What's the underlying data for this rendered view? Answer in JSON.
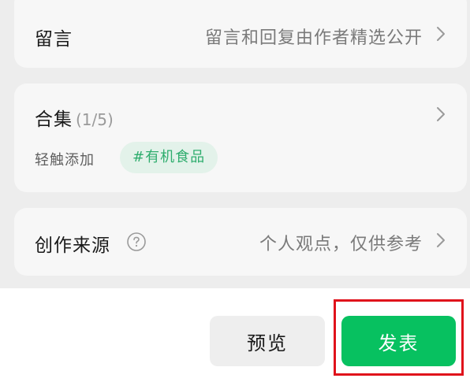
{
  "comments": {
    "label": "留言",
    "value": "留言和回复由作者精选公开"
  },
  "collection": {
    "label": "合集",
    "count": "(1/5)",
    "hint": "轻触添加",
    "tag": "#有机食品"
  },
  "source": {
    "label": "创作来源",
    "value": "个人观点，仅供参考"
  },
  "footer": {
    "preview_label": "预览",
    "publish_label": "发表"
  },
  "colors": {
    "accent": "#07c160",
    "tag_text": "#2fad6e",
    "highlight": "#e0121b"
  }
}
